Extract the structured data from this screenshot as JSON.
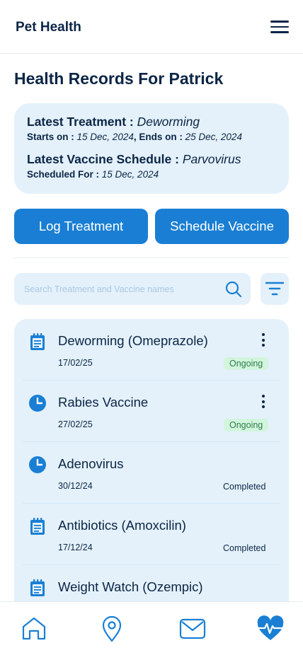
{
  "header": {
    "app_title": "Pet Health",
    "menu_icon": "hamburger-menu-icon"
  },
  "page_title": "Health Records For Patrick",
  "summary": {
    "treatment_label": "Latest Treatment :",
    "treatment_value": "Deworming",
    "starts_label": "Starts on :",
    "starts_value": "15 Dec, 2024",
    "separator": ",",
    "ends_label": "Ends on :",
    "ends_value": "25 Dec, 2024",
    "vaccine_label": "Latest Vaccine Schedule :",
    "vaccine_value": "Parvovirus",
    "scheduled_label": "Scheduled For :",
    "scheduled_value": "15 Dec, 2024"
  },
  "actions": {
    "log_treatment": "Log Treatment",
    "schedule_vaccine": "Schedule Vaccine"
  },
  "search": {
    "placeholder": "Search Treatment and Vaccine names",
    "value": ""
  },
  "records": [
    {
      "title": "Deworming (Omeprazole)",
      "date": "17/02/25",
      "status": "Ongoing",
      "icon": "clipboard-icon"
    },
    {
      "title": "Rabies Vaccine",
      "date": "27/02/25",
      "status": "Ongoing",
      "icon": "clock-icon"
    },
    {
      "title": "Adenovirus",
      "date": "30/12/24",
      "status": "Completed",
      "icon": "clock-icon"
    },
    {
      "title": "Antibiotics (Amoxcilin)",
      "date": "17/12/24",
      "status": "Completed",
      "icon": "clipboard-icon"
    },
    {
      "title": "Weight Watch (Ozempic)",
      "date": "",
      "status": "",
      "icon": "clipboard-icon"
    }
  ],
  "nav": [
    "home-icon",
    "location-pin-icon",
    "mail-icon",
    "heart-pulse-icon"
  ],
  "colors": {
    "primary": "#1a7fd4",
    "panel": "#e4f1fb",
    "text": "#0b2545",
    "ongoing_bg": "#d2f5dd",
    "ongoing_text": "#2f7d4a"
  }
}
